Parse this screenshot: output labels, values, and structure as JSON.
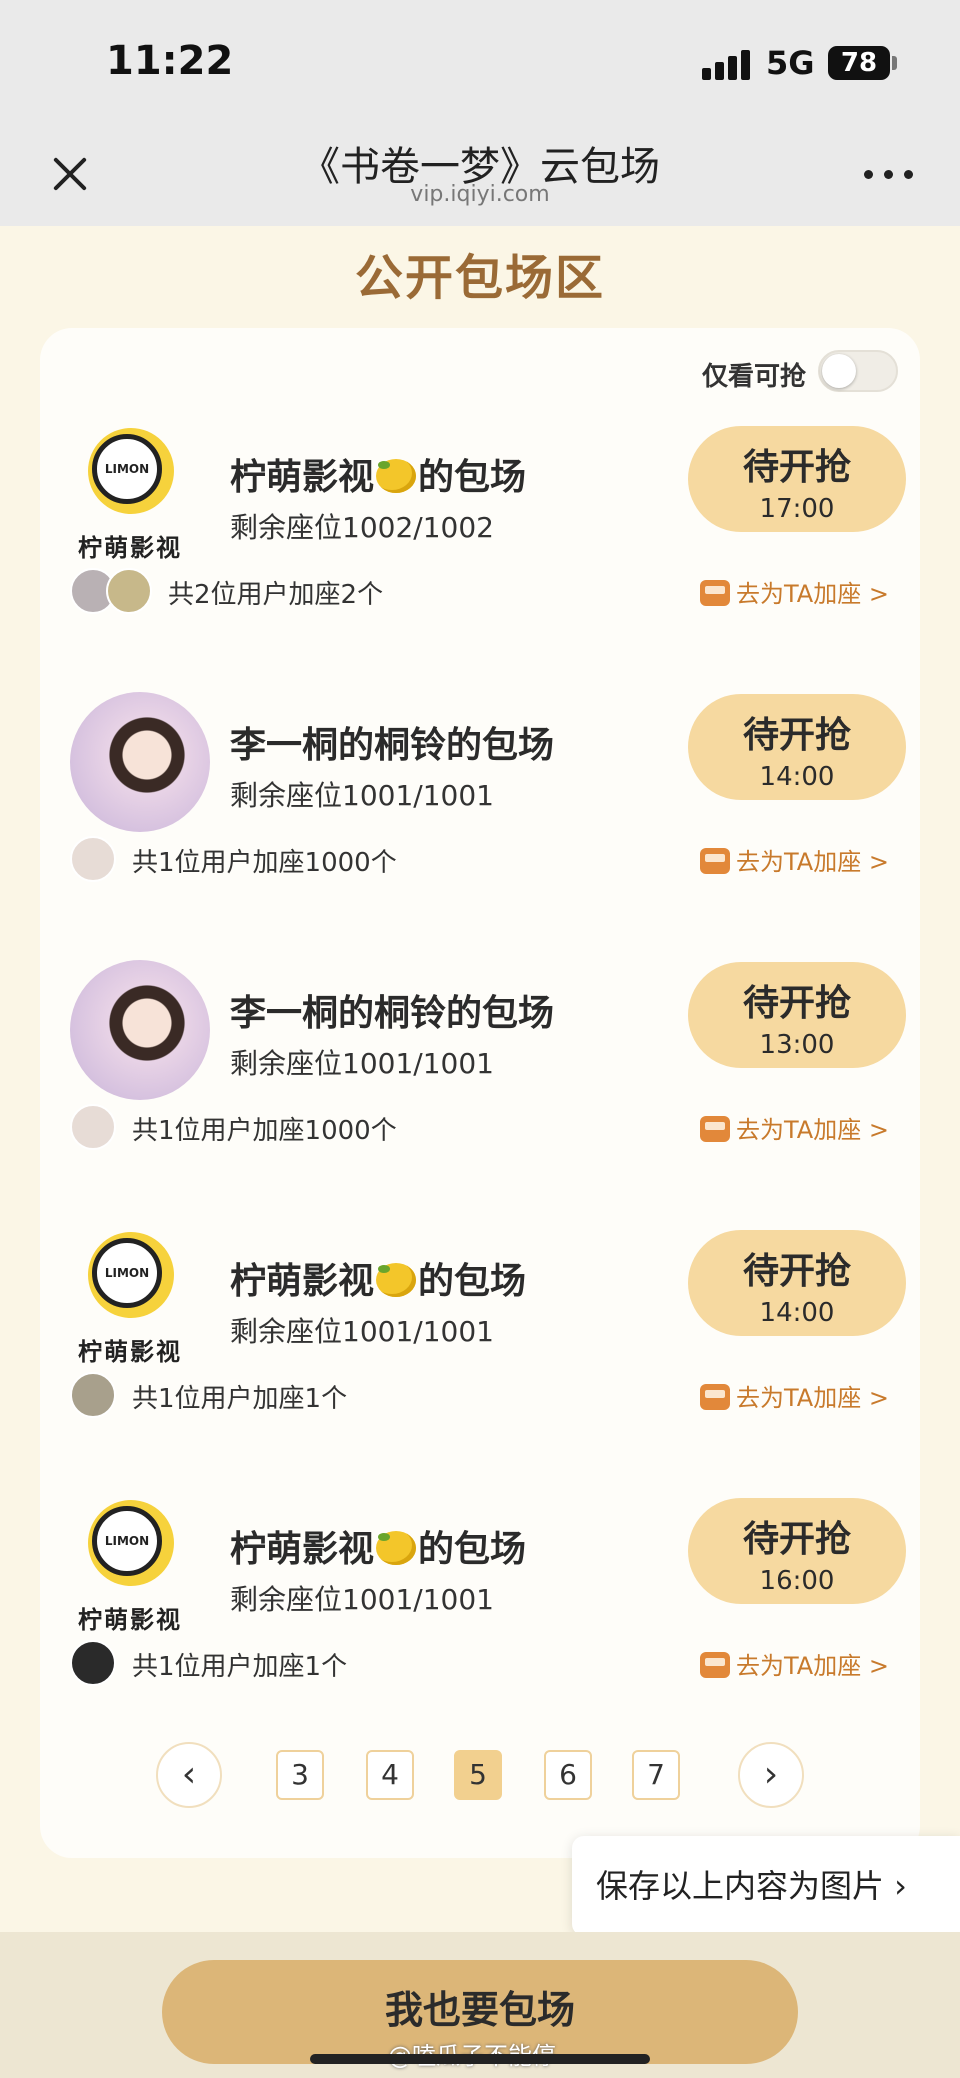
{
  "status_bar": {
    "time": "11:22",
    "network": "5G",
    "battery": "78"
  },
  "nav": {
    "title": "《书卷一梦》云包场",
    "subtitle": "vip.iqiyi.com"
  },
  "section": {
    "title": "公开包场区",
    "filter_label": "仅看可抢",
    "filter_on": false
  },
  "sessions": [
    {
      "host": "柠萌影视",
      "title_suffix": "的包场",
      "has_lemon": true,
      "seats": "剩余座位1002/1002",
      "status": "待开抢",
      "time": "17:00",
      "users": "共2位用户加座2个",
      "action": "去为TA加座 >"
    },
    {
      "host": "李一桐的桐铃",
      "title_suffix": "的包场",
      "has_lemon": false,
      "seats": "剩余座位1001/1001",
      "status": "待开抢",
      "time": "14:00",
      "users": "共1位用户加座1000个",
      "action": "去为TA加座 >"
    },
    {
      "host": "李一桐的桐铃",
      "title_suffix": "的包场",
      "has_lemon": false,
      "seats": "剩余座位1001/1001",
      "status": "待开抢",
      "time": "13:00",
      "users": "共1位用户加座1000个",
      "action": "去为TA加座 >"
    },
    {
      "host": "柠萌影视",
      "title_suffix": "的包场",
      "has_lemon": true,
      "seats": "剩余座位1001/1001",
      "status": "待开抢",
      "time": "14:00",
      "users": "共1位用户加座1个",
      "action": "去为TA加座 >"
    },
    {
      "host": "柠萌影视",
      "title_suffix": "的包场",
      "has_lemon": true,
      "seats": "剩余座位1001/1001",
      "status": "待开抢",
      "time": "16:00",
      "users": "共1位用户加座1个",
      "action": "去为TA加座 >"
    }
  ],
  "logo": {
    "inner_text": "LIMON",
    "caption": "柠萌影视"
  },
  "pagination": {
    "prev": "‹",
    "next": "›",
    "pages": [
      "3",
      "4",
      "5",
      "6",
      "7"
    ],
    "current": "5"
  },
  "save_image": "保存以上内容为图片 ›",
  "cta": "我也要包场",
  "watermark": "@嗑瓜子不能停"
}
